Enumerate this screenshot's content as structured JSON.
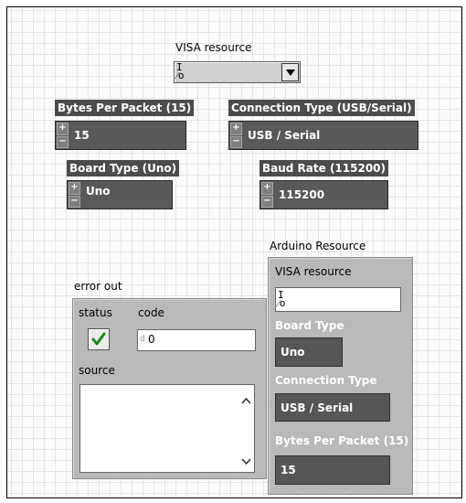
{
  "visa_resource": {
    "label": "VISA resource",
    "icon": "visa-resource-glyph",
    "value": ""
  },
  "controls": {
    "bytes_per_packet": {
      "label": "Bytes Per Packet (15)",
      "value": "15"
    },
    "connection_type": {
      "label": "Connection Type (USB/Serial)",
      "value": "USB / Serial"
    },
    "board_type": {
      "label": "Board Type (Uno)",
      "value": "Uno"
    },
    "baud_rate": {
      "label": "Baud Rate (115200)",
      "value": "115200"
    }
  },
  "error_out": {
    "title": "error out",
    "status_label": "status",
    "status_checked": true,
    "code_label": "code",
    "code_value": "0",
    "code_prefix": "d",
    "source_label": "source",
    "source_value": ""
  },
  "arduino_resource": {
    "title": "Arduino Resource",
    "visa_label": "VISA resource",
    "visa_value": "",
    "board_type_label": "Board Type",
    "board_type_value": "Uno",
    "connection_type_label": "Connection Type",
    "connection_type_value": "USB / Serial",
    "bytes_label": "Bytes Per Packet (15)",
    "bytes_value": "15"
  },
  "colors": {
    "control_bg": "#595959",
    "cluster_bg": "#b9b9b9",
    "check": "#1a8a1a"
  }
}
